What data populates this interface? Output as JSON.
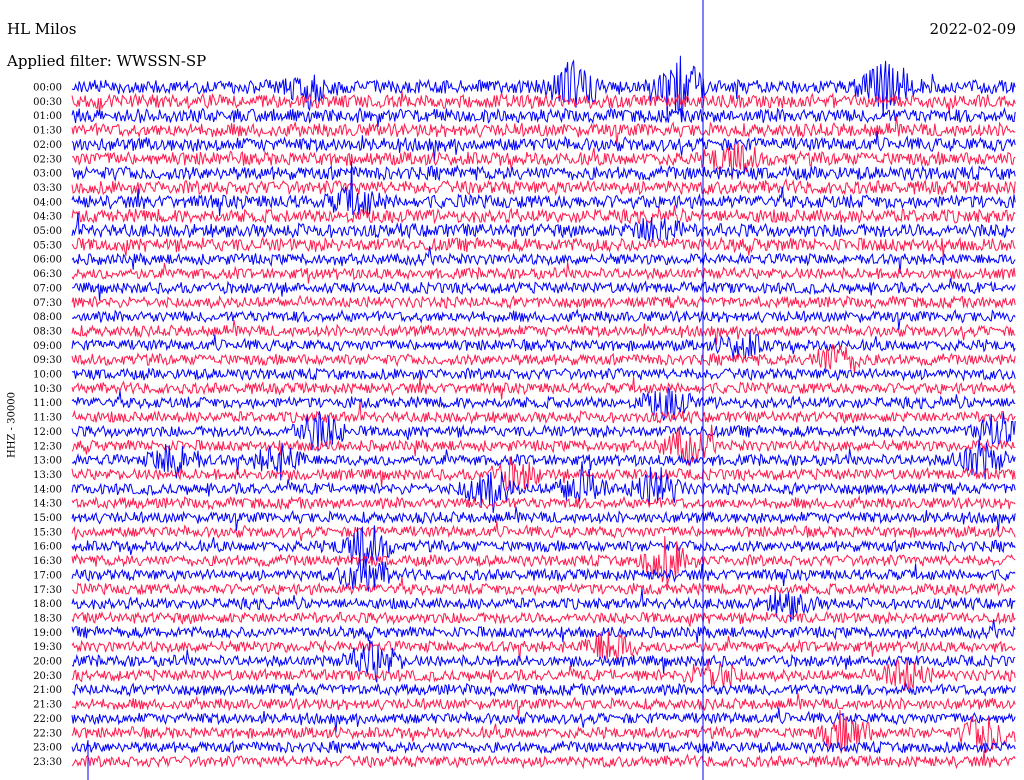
{
  "header": {
    "station": "HL Milos",
    "date": "2022-02-09",
    "filter": "Applied filter: WWSSN-SP",
    "channel": "HHZ - 30000"
  },
  "colors": {
    "trace_a": "#0000ff",
    "trace_b": "#ff1a4d",
    "grid": "#000000"
  },
  "chart_data": {
    "type": "line",
    "title": "HL Milos",
    "subtitle": "Applied filter: WWSSN-SP",
    "date": "2022-02-09",
    "ylabel": "HHZ - 30000",
    "rows": [
      "00:00",
      "00:30",
      "01:00",
      "01:30",
      "02:00",
      "02:30",
      "03:00",
      "03:30",
      "04:00",
      "04:30",
      "05:00",
      "05:30",
      "06:00",
      "06:30",
      "07:00",
      "07:30",
      "08:00",
      "08:30",
      "09:00",
      "09:30",
      "10:00",
      "10:30",
      "11:00",
      "11:30",
      "12:00",
      "12:30",
      "13:00",
      "13:30",
      "14:00",
      "14:30",
      "15:00",
      "15:30",
      "16:00",
      "16:30",
      "17:00",
      "17:30",
      "18:00",
      "18:30",
      "19:00",
      "19:30",
      "20:00",
      "20:30",
      "21:00",
      "21:30",
      "22:00",
      "22:30",
      "23:00",
      "23:30"
    ],
    "series": [
      {
        "values": []
      },
      {
        "values": []
      }
    ],
    "events": [
      {
        "row": "00:00",
        "t": 0.53,
        "amp": 2.2
      },
      {
        "row": "00:00",
        "t": 0.64,
        "amp": 3.0
      },
      {
        "row": "00:00",
        "t": 0.86,
        "amp": 2.6
      },
      {
        "row": "00:00",
        "t": 0.25,
        "amp": 1.6
      },
      {
        "row": "02:30",
        "t": 0.7,
        "amp": 1.4
      },
      {
        "row": "04:00",
        "t": 0.3,
        "amp": 1.3
      },
      {
        "row": "05:00",
        "t": 0.62,
        "amp": 1.2
      },
      {
        "row": "09:00",
        "t": 0.71,
        "amp": 1.3
      },
      {
        "row": "09:30",
        "t": 0.81,
        "amp": 1.8
      },
      {
        "row": "11:00",
        "t": 0.63,
        "amp": 1.6
      },
      {
        "row": "12:00",
        "t": 0.26,
        "amp": 2.2
      },
      {
        "row": "12:00",
        "t": 0.98,
        "amp": 1.8
      },
      {
        "row": "12:30",
        "t": 0.65,
        "amp": 1.8
      },
      {
        "row": "13:00",
        "t": 0.11,
        "amp": 2.0
      },
      {
        "row": "13:00",
        "t": 0.22,
        "amp": 1.6
      },
      {
        "row": "13:00",
        "t": 0.96,
        "amp": 2.0
      },
      {
        "row": "13:30",
        "t": 0.47,
        "amp": 1.6
      },
      {
        "row": "14:00",
        "t": 0.44,
        "amp": 2.4
      },
      {
        "row": "14:00",
        "t": 0.54,
        "amp": 2.2
      },
      {
        "row": "14:00",
        "t": 0.62,
        "amp": 2.2
      },
      {
        "row": "16:00",
        "t": 0.31,
        "amp": 2.4
      },
      {
        "row": "16:30",
        "t": 0.63,
        "amp": 2.4
      },
      {
        "row": "17:00",
        "t": 0.31,
        "amp": 2.0
      },
      {
        "row": "18:00",
        "t": 0.76,
        "amp": 1.4
      },
      {
        "row": "19:30",
        "t": 0.57,
        "amp": 1.8
      },
      {
        "row": "20:00",
        "t": 0.32,
        "amp": 2.2
      },
      {
        "row": "20:30",
        "t": 0.68,
        "amp": 1.8
      },
      {
        "row": "20:30",
        "t": 0.88,
        "amp": 1.8
      },
      {
        "row": "22:30",
        "t": 0.82,
        "amp": 2.2
      },
      {
        "row": "22:30",
        "t": 0.97,
        "amp": 2.4
      }
    ],
    "grid": false,
    "legend": "none"
  }
}
